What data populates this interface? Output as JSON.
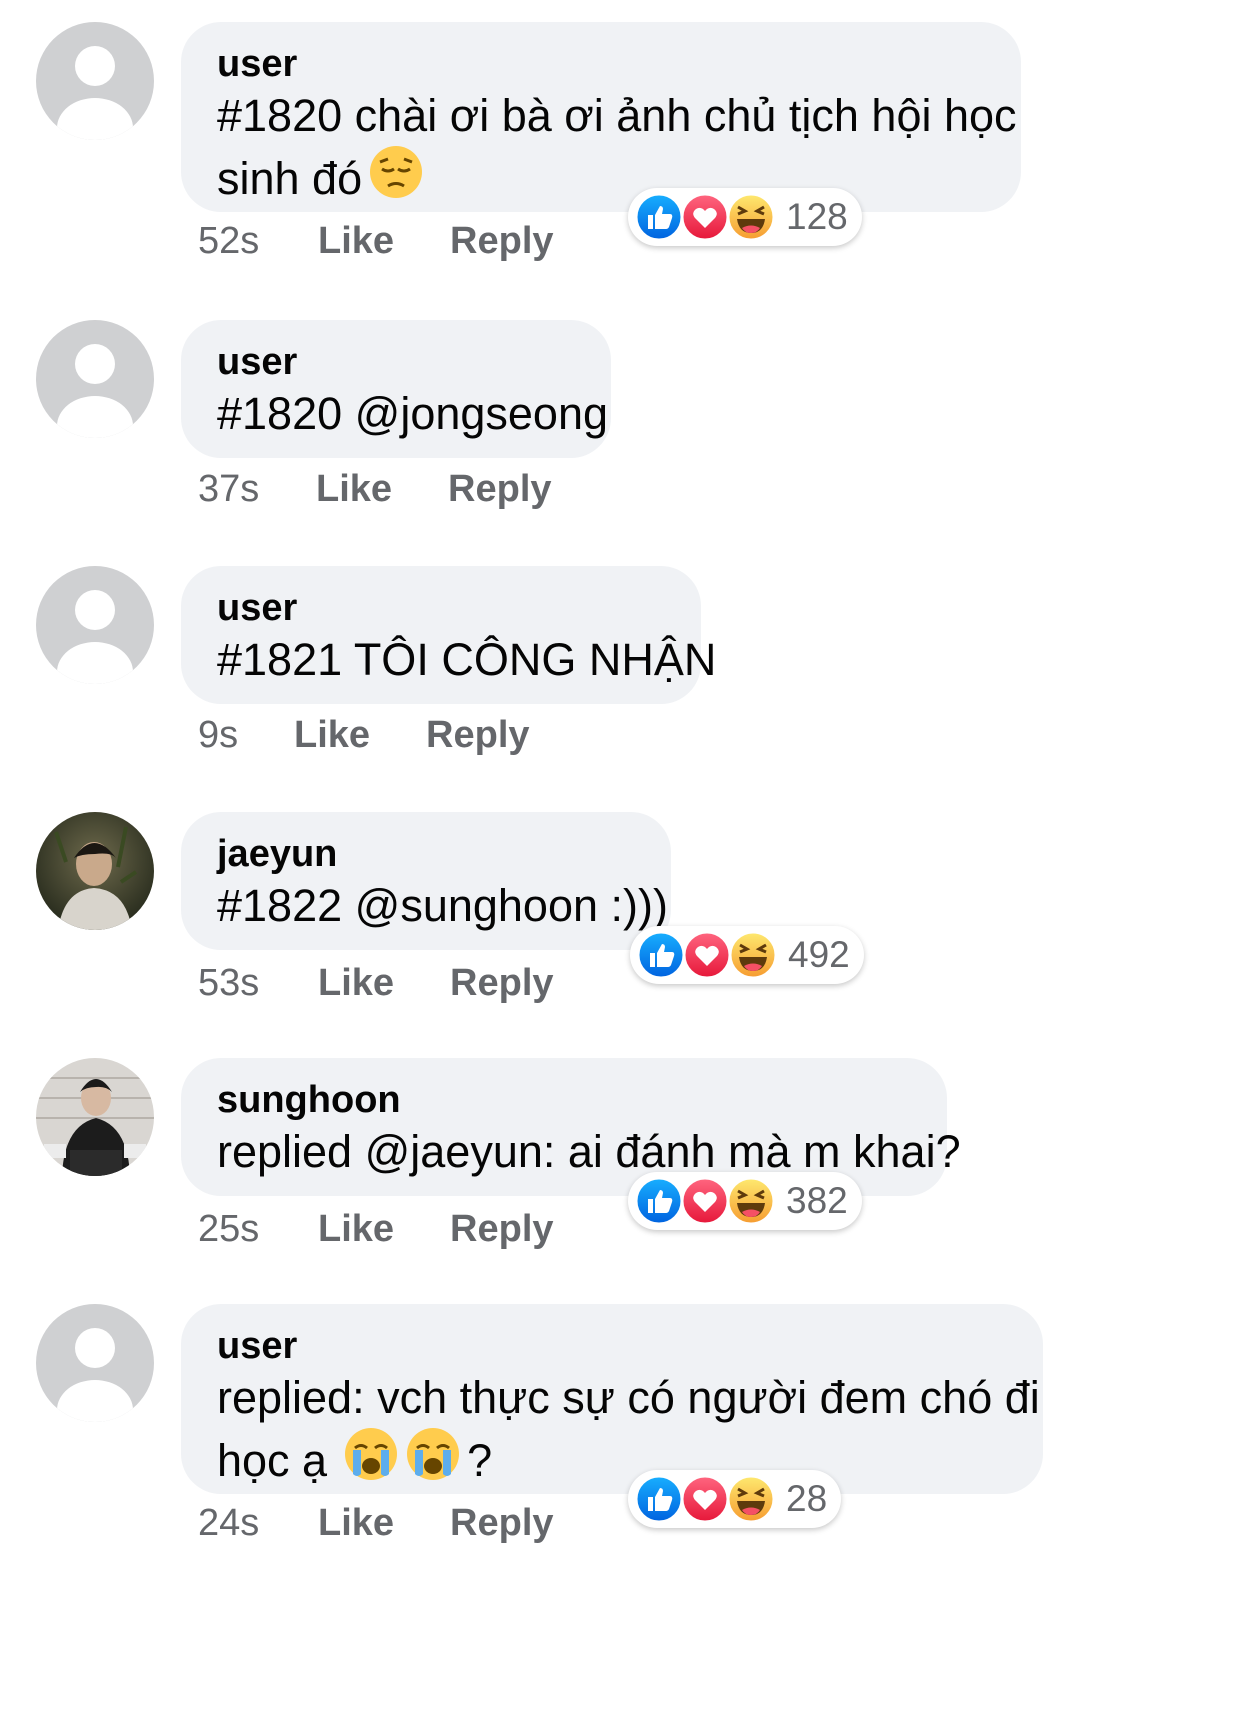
{
  "comments": [
    {
      "author": "user",
      "line1": "#1820 chài ơi bà ơi ảnh chủ tịch hội học",
      "line2": "sinh đó",
      "emoji": "pensive-face-icon",
      "time": "52s",
      "like": "Like",
      "reply": "Reply",
      "reactions": {
        "icons": [
          "like-icon",
          "love-icon",
          "haha-icon"
        ],
        "count": "128"
      }
    },
    {
      "author": "user",
      "line1": "#1820 @jongseong",
      "time": "37s",
      "like": "Like",
      "reply": "Reply"
    },
    {
      "author": "user",
      "line1": "#1821 TÔI CÔNG NHẬN",
      "time": "9s",
      "like": "Like",
      "reply": "Reply"
    },
    {
      "author": "jaeyun",
      "line1": "#1822 @sunghoon :)))",
      "time": "53s",
      "like": "Like",
      "reply": "Reply",
      "reactions": {
        "icons": [
          "like-icon",
          "love-icon",
          "haha-icon"
        ],
        "count": "492"
      }
    },
    {
      "author": "sunghoon",
      "line1": "replied @jaeyun: ai đánh mà m khai?",
      "time": "25s",
      "like": "Like",
      "reply": "Reply",
      "reactions": {
        "icons": [
          "like-icon",
          "love-icon",
          "haha-icon"
        ],
        "count": "382"
      }
    },
    {
      "author": "user",
      "line1": "replied: vch thực sự có người đem chó đi",
      "line2": "học ạ",
      "line2_suffix": "?",
      "emoji": "loudly-crying-face-icon",
      "time": "24s",
      "like": "Like",
      "reply": "Reply",
      "reactions": {
        "icons": [
          "like-icon",
          "love-icon",
          "haha-icon"
        ],
        "count": "28"
      }
    }
  ],
  "colors": {
    "bubble": "#f0f2f5",
    "meta_text": "#65676b",
    "like_blue": "#1877f2",
    "love_red": "#f33e58",
    "haha_yellow": "#f7b125"
  }
}
